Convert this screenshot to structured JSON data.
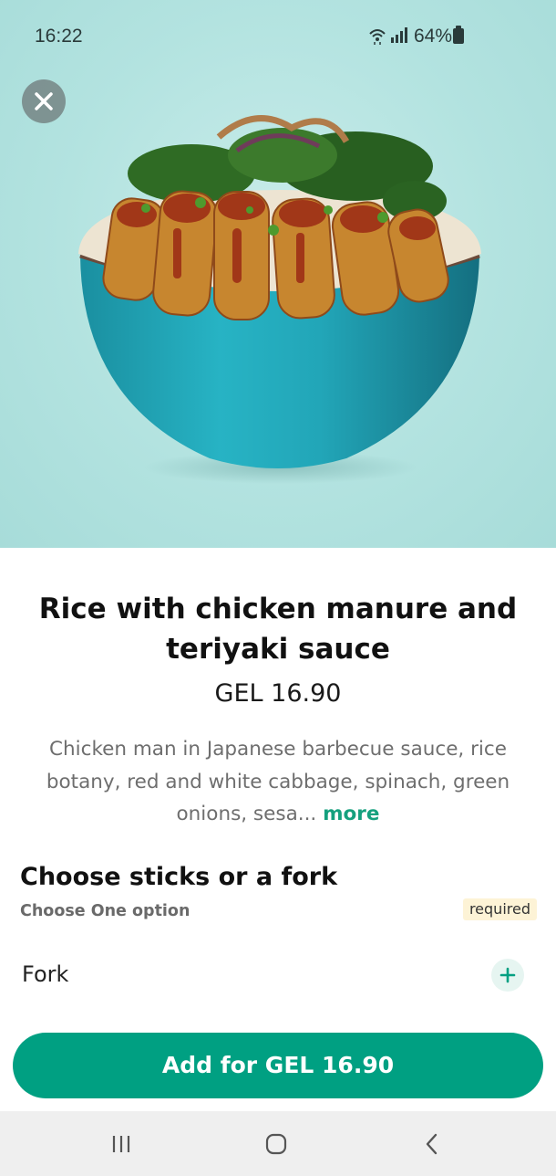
{
  "status_bar": {
    "time": "16:22",
    "battery": "64%",
    "icons": [
      "wifi-icon",
      "signal-icon",
      "battery-icon"
    ]
  },
  "hero": {
    "close_icon": "close-icon"
  },
  "product": {
    "title": "Rice with chicken manure and teriyaki sauce",
    "price": "GEL 16.90",
    "description": "Chicken man in Japanese barbecue sauce, rice botany, red and white cabbage, spinach, green onions, sesa...",
    "more_label": "more"
  },
  "options_section": {
    "title": "Choose sticks or a fork",
    "subtitle": "Choose One option",
    "badge": "required",
    "items": [
      {
        "label": "Fork",
        "action_icon": "plus-icon"
      }
    ]
  },
  "cta": {
    "label": "Add for GEL 16.90"
  },
  "nav_bar": {
    "items": [
      "recent-apps-icon",
      "home-icon",
      "back-icon"
    ]
  },
  "colors": {
    "accent": "#00a082",
    "more_link": "#15a07e",
    "badge_bg": "#fdf3d6",
    "hero_bg": "#b3e3e0"
  }
}
